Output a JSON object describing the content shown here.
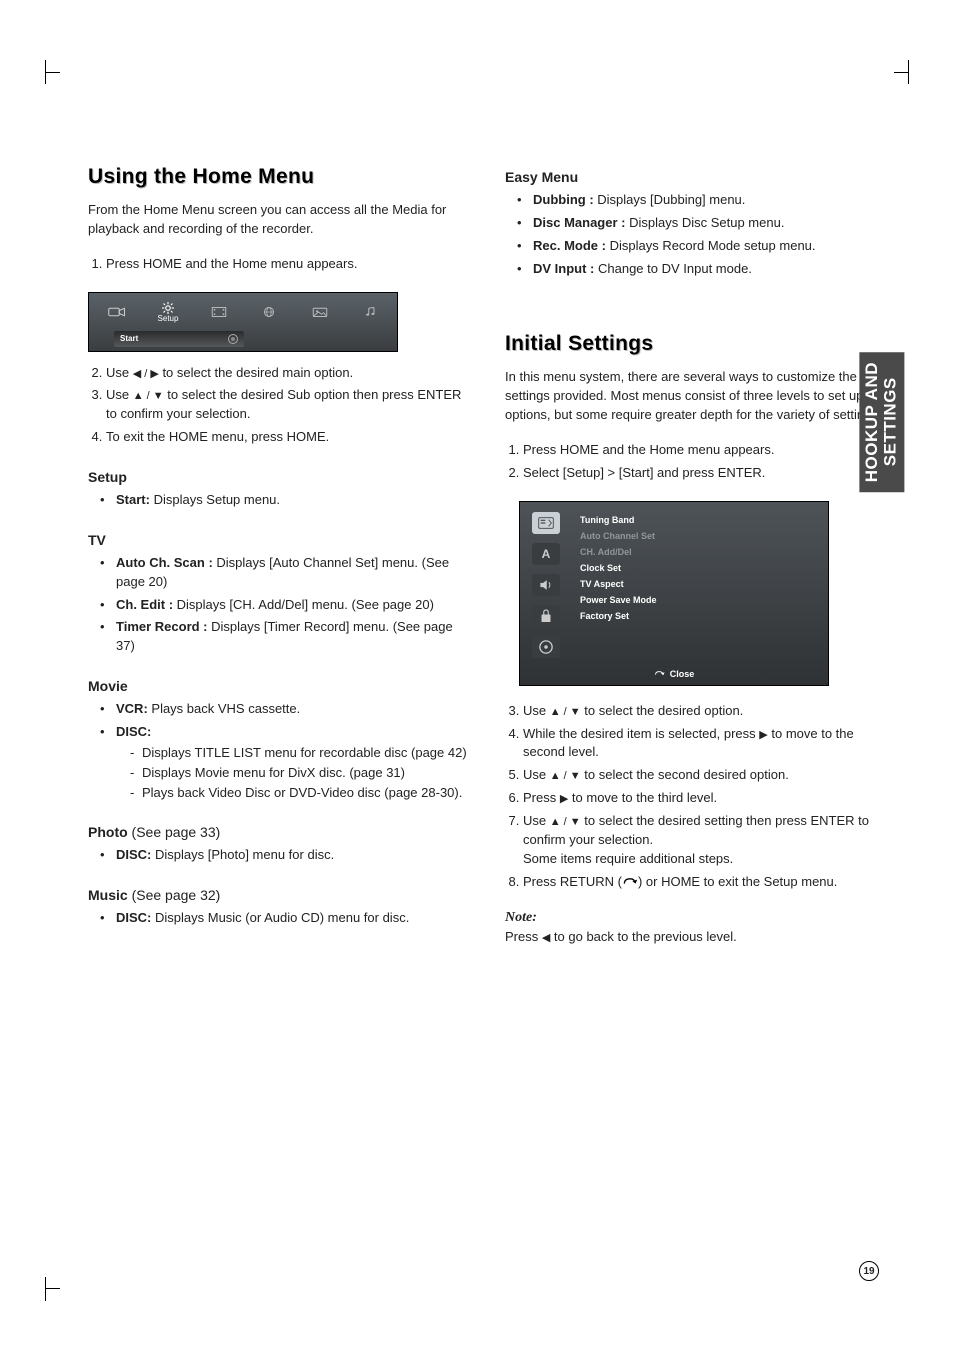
{
  "sideTab": {
    "line1": "HOOKUP AND",
    "line2": "SETTINGS"
  },
  "pageNumber": "19",
  "left": {
    "title": "Using the Home Menu",
    "intro": "From the Home Menu screen you can access all the Media for playback and recording of the recorder.",
    "steps1": [
      "Press HOME and the Home menu appears."
    ],
    "menuShot": {
      "setupLabel": "Setup",
      "startLabel": "Start"
    },
    "steps2": [
      {
        "pre": "Use ",
        "arrows": "◀ / ▶",
        "post": " to select the desired main option."
      },
      {
        "pre": "Use ",
        "arrows": "▲ / ▼",
        "post": " to select the desired Sub option then press ENTER to confirm your selection."
      },
      {
        "plain": "To exit the HOME menu, press HOME."
      }
    ],
    "setup": {
      "head": "Setup",
      "items": [
        {
          "b": "Start:",
          "t": " Displays Setup menu."
        }
      ]
    },
    "tv": {
      "head": "TV",
      "items": [
        {
          "b": "Auto Ch. Scan :",
          "t": " Displays [Auto Channel Set] menu. (See page 20)"
        },
        {
          "b": "Ch. Edit :",
          "t": " Displays [CH. Add/Del] menu. (See page 20)"
        },
        {
          "b": "Timer Record :",
          "t": " Displays [Timer Record] menu. (See page 37)"
        }
      ]
    },
    "movie": {
      "head": "Movie",
      "items": [
        {
          "b": "VCR:",
          "t": " Plays back VHS cassette."
        },
        {
          "b": "DISC:",
          "t": "",
          "sub": [
            "Displays TITLE LIST menu for recordable disc (page 42)",
            "Displays Movie menu for DivX disc. (page 31)",
            "Plays back Video Disc or DVD-Video disc (page 28-30)."
          ]
        }
      ]
    },
    "photo": {
      "head": "Photo",
      "headNote": " (See page 33)",
      "items": [
        {
          "b": "DISC:",
          "t": " Displays [Photo] menu for disc."
        }
      ]
    },
    "music": {
      "head": "Music",
      "headNote": " (See page 32)",
      "items": [
        {
          "b": "DISC:",
          "t": " Displays Music (or Audio CD) menu for disc."
        }
      ]
    }
  },
  "right": {
    "easyMenu": {
      "head": "Easy Menu",
      "items": [
        {
          "b": "Dubbing :",
          "t": " Displays [Dubbing] menu."
        },
        {
          "b": "Disc Manager :",
          "t": " Displays Disc Setup menu."
        },
        {
          "b": "Rec. Mode :",
          "t": " Displays Record Mode setup menu."
        },
        {
          "b": "DV Input :",
          "t": " Change to DV Input mode."
        }
      ]
    },
    "initial": {
      "title": "Initial Settings",
      "intro": "In this menu system, there are several ways to customize the settings provided. Most menus consist of three levels to set up the options, but some require greater depth for the variety of settings.",
      "stepsA": [
        "Press HOME and the Home menu appears.",
        "Select [Setup] > [Start] and press ENTER."
      ],
      "settingsShot": {
        "items": [
          {
            "label": "Tuning Band",
            "dim": false
          },
          {
            "label": "Auto Channel Set",
            "dim": true
          },
          {
            "label": "CH. Add/Del",
            "dim": true
          },
          {
            "label": "Clock Set",
            "dim": false
          },
          {
            "label": "TV Aspect",
            "dim": false
          },
          {
            "label": "Power Save Mode",
            "dim": false
          },
          {
            "label": "Factory Set",
            "dim": false
          }
        ],
        "close": "Close"
      },
      "stepsB": [
        {
          "pre": "Use ",
          "arrows": "▲ / ▼",
          "post": " to select the desired option."
        },
        {
          "pre": "While the desired item is selected, press ",
          "arrows": "▶",
          "post": " to move to the second level."
        },
        {
          "pre": "Use ",
          "arrows": "▲ / ▼",
          "post": " to select the second desired option."
        },
        {
          "pre": "Press ",
          "arrows": "▶",
          "post": " to move to the third level."
        },
        {
          "pre": "Use ",
          "arrows": "▲ / ▼",
          "post": " to select the desired setting then press ENTER to confirm your selection.\nSome items require additional steps."
        },
        {
          "pre": "Press RETURN (",
          "ret": true,
          "post": ") or HOME to exit the Setup menu."
        }
      ],
      "noteLabel": "Note:",
      "noteText": {
        "pre": "Press ",
        "arrows": "◀",
        "post": " to go back to the previous level."
      }
    }
  }
}
